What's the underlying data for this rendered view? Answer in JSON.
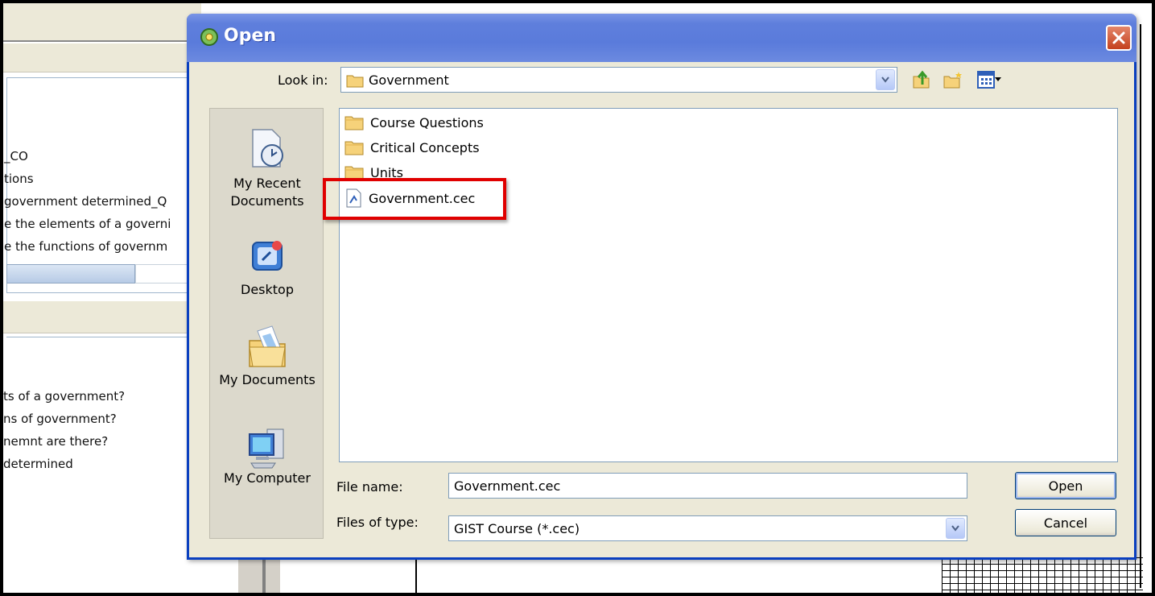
{
  "background": {
    "lines": [
      "_CO",
      "tions",
      "government determined_Q",
      "e the elements of a governi",
      "e the functions of governm",
      "ts of a government?",
      "ns of government?",
      "nemnt are there?",
      " determined"
    ]
  },
  "dialog": {
    "title": "Open",
    "look_in_label": "Look in:",
    "look_in_value": "Government",
    "places": [
      {
        "label": "My Recent\nDocuments",
        "icon": "recent-documents-icon"
      },
      {
        "label": "Desktop",
        "icon": "desktop-icon"
      },
      {
        "label": "My Documents",
        "icon": "my-documents-icon"
      },
      {
        "label": "My Computer",
        "icon": "my-computer-icon"
      }
    ],
    "files": [
      {
        "name": "Course Questions",
        "type": "folder"
      },
      {
        "name": "Critical Concepts",
        "type": "folder"
      },
      {
        "name": "Units",
        "type": "folder"
      },
      {
        "name": "Government.cec",
        "type": "file"
      }
    ],
    "file_name_label": "File name:",
    "file_name_value": "Government.cec",
    "files_of_type_label": "Files of type:",
    "files_of_type_value": "GIST Course (*.cec)",
    "open_label": "Open",
    "cancel_label": "Cancel"
  },
  "colors": {
    "titlebar": "#5a7bdb",
    "dialog_bg": "#ece9d8",
    "highlight": "#e00000"
  }
}
